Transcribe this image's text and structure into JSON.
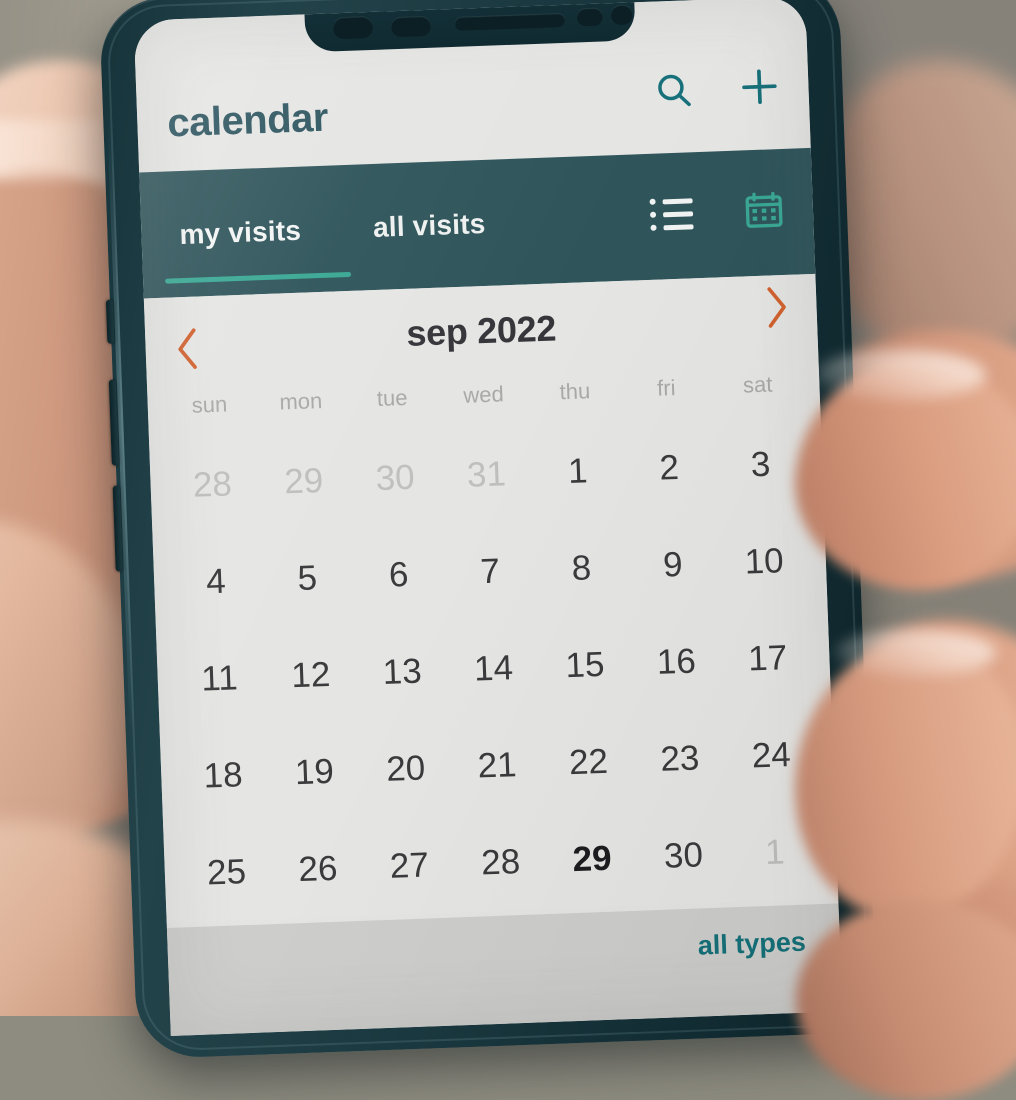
{
  "app": {
    "title": "calendar",
    "header_icons": [
      {
        "name": "search-icon",
        "label": "search"
      },
      {
        "name": "plus-icon",
        "label": "add"
      }
    ]
  },
  "tabs": {
    "items": [
      {
        "label": "my visits",
        "active": true
      },
      {
        "label": "all visits",
        "active": false
      }
    ],
    "view_toggles": [
      {
        "name": "list-view-icon",
        "label": "list view",
        "active": false
      },
      {
        "name": "calendar-view-icon",
        "label": "calendar view",
        "active": true
      }
    ]
  },
  "month_nav": {
    "prev_label": "‹",
    "next_label": "›",
    "current_month": "sep 2022"
  },
  "calendar": {
    "weekdays": [
      "sun",
      "mon",
      "tue",
      "wed",
      "thu",
      "fri",
      "sat"
    ],
    "weeks": [
      [
        {
          "d": "28",
          "state": "muted"
        },
        {
          "d": "29",
          "state": "muted"
        },
        {
          "d": "30",
          "state": "muted"
        },
        {
          "d": "31",
          "state": "muted"
        },
        {
          "d": "1",
          "state": "normal"
        },
        {
          "d": "2",
          "state": "normal"
        },
        {
          "d": "3",
          "state": "normal"
        }
      ],
      [
        {
          "d": "4",
          "state": "normal"
        },
        {
          "d": "5",
          "state": "normal"
        },
        {
          "d": "6",
          "state": "normal"
        },
        {
          "d": "7",
          "state": "normal"
        },
        {
          "d": "8",
          "state": "normal"
        },
        {
          "d": "9",
          "state": "normal"
        },
        {
          "d": "10",
          "state": "normal"
        }
      ],
      [
        {
          "d": "11",
          "state": "normal"
        },
        {
          "d": "12",
          "state": "normal"
        },
        {
          "d": "13",
          "state": "normal"
        },
        {
          "d": "14",
          "state": "normal"
        },
        {
          "d": "15",
          "state": "normal"
        },
        {
          "d": "16",
          "state": "normal"
        },
        {
          "d": "17",
          "state": "normal"
        }
      ],
      [
        {
          "d": "18",
          "state": "normal"
        },
        {
          "d": "19",
          "state": "normal"
        },
        {
          "d": "20",
          "state": "normal"
        },
        {
          "d": "21",
          "state": "normal"
        },
        {
          "d": "22",
          "state": "normal"
        },
        {
          "d": "23",
          "state": "normal"
        },
        {
          "d": "24",
          "state": "normal"
        }
      ],
      [
        {
          "d": "25",
          "state": "normal"
        },
        {
          "d": "26",
          "state": "normal"
        },
        {
          "d": "27",
          "state": "normal"
        },
        {
          "d": "28",
          "state": "normal"
        },
        {
          "d": "29",
          "state": "today"
        },
        {
          "d": "30",
          "state": "normal"
        },
        {
          "d": "1",
          "state": "muted"
        }
      ]
    ]
  },
  "bottom_bar": {
    "filter_label": "all types"
  },
  "colors": {
    "teal_bar": "#2f555b",
    "accent_teal": "#17707a",
    "indicator_green": "#3aa894",
    "chevron_orange": "#d2622f",
    "screen_bg": "#e5e5e3",
    "bottom_bar_bg": "#cdcdcb",
    "title_color": "#2d5560"
  }
}
